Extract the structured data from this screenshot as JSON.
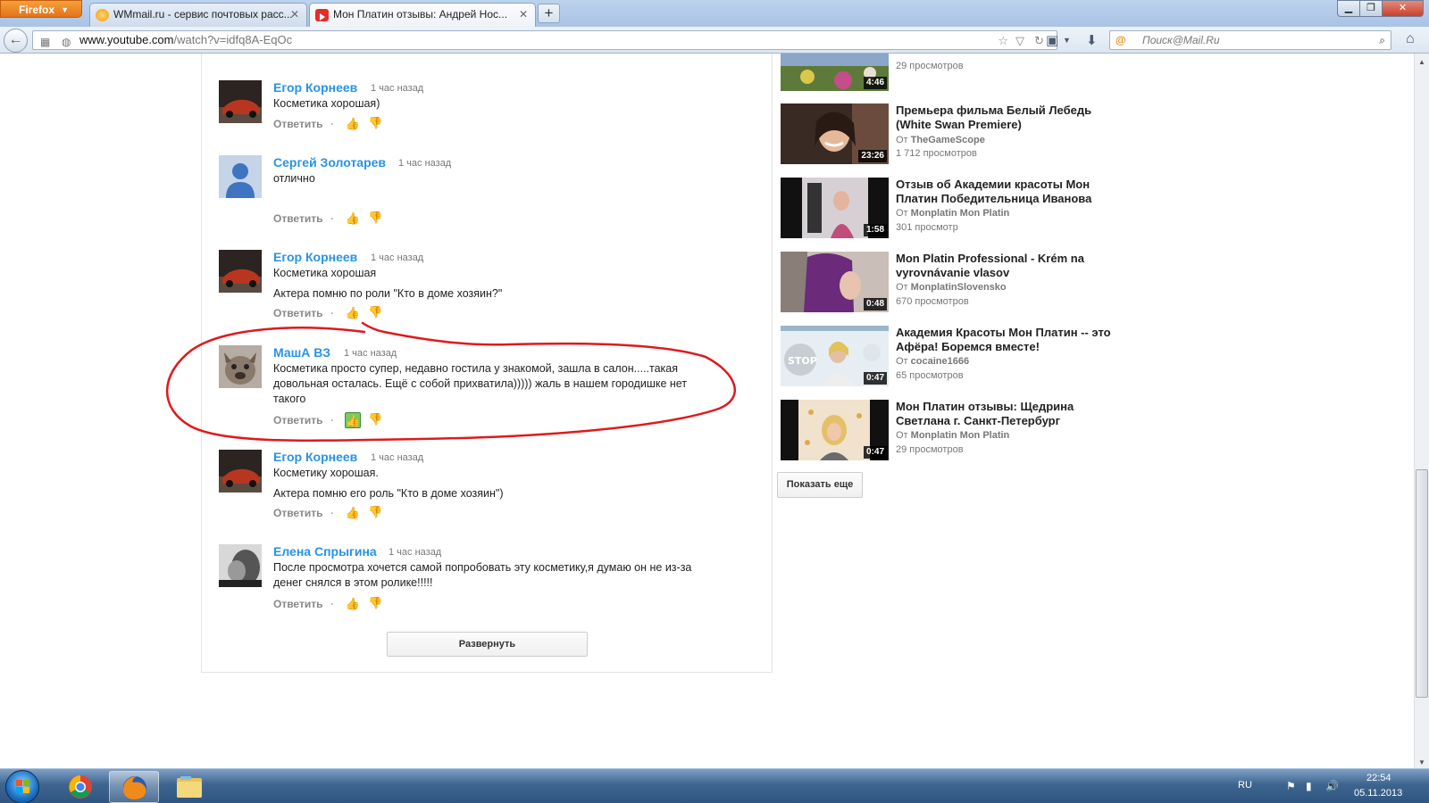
{
  "browser": {
    "menu_label": "Firefox",
    "tabs": [
      {
        "title": "WMmail.ru - сервис почтовых расс...",
        "active": false
      },
      {
        "title": "Мон Платин отзывы: Андрей Нос...",
        "active": true
      }
    ],
    "url_host": "www.youtube.com",
    "url_path": "/watch?v=idfq8A-EqOc",
    "search_placeholder": "Поиск@Mail.Ru"
  },
  "comments": [
    {
      "author": "Егор Корнеев",
      "time": "1 час назад",
      "lines": [
        "Косметика хорошая)"
      ],
      "liked": false
    },
    {
      "author": "Сергей Золотарев",
      "time": "1 час назад",
      "lines": [
        "отлично"
      ],
      "liked": false
    },
    {
      "author": "Егор Корнеев",
      "time": "1 час назад",
      "lines": [
        "Косметика хорошая",
        "Актера помню по роли \"Кто в доме хозяин?\""
      ],
      "liked": false
    },
    {
      "author": "МашА ВЗ",
      "time": "1 час назад",
      "lines": [
        "Косметика просто супер, недавно гостила у знакомой, зашла в салон.....такая довольная осталась. Ещё с собой прихватила))))) жаль в нашем городишке нет такого"
      ],
      "liked": true
    },
    {
      "author": "Егор Корнеев",
      "time": "1 час назад",
      "lines": [
        "Косметику хорошая.",
        "Актера помню его роль \"Кто в доме хозяин\")"
      ],
      "liked": false
    },
    {
      "author": "Елена Спрыгина",
      "time": "1 час назад",
      "lines": [
        "После просмотра хочется самой попробовать эту косметику,я думаю он не из-за денег снялся в этом ролике!!!!!"
      ],
      "liked": false
    }
  ],
  "reply_label": "Ответить",
  "expand_label": "Развернуть",
  "sidebar": {
    "top_views": "29 просмотров",
    "top_duration": "4:46",
    "channel_prefix": "От",
    "videos": [
      {
        "title": "Премьера фильма Белый Лебедь (White Swan Premiere)",
        "channel": "TheGameScope",
        "views": "1 712 просмотров",
        "duration": "23:26"
      },
      {
        "title": "Отзыв об Академии красоты Мон Платин Победительница Иванова",
        "channel": "Monplatin Mon Platin",
        "views": "301 просмотр",
        "duration": "1:58"
      },
      {
        "title": "Mon Platin Professional - Krém na vyrovnávanie vlasov",
        "channel": "MonplatinSlovensko",
        "views": "670 просмотров",
        "duration": "0:48"
      },
      {
        "title": "Академия Красоты Мон Платин -- это Афёра! Боремся вместе!",
        "channel": "cocaine1666",
        "views": "65 просмотров",
        "duration": "0:47"
      },
      {
        "title": "Мон Платин отзывы: Щедрина Светлана г. Санкт-Петербург",
        "channel": "Monplatin Mon Platin",
        "views": "29 просмотров",
        "duration": "0:47"
      }
    ],
    "show_more_label": "Показать еще"
  },
  "taskbar": {
    "language": "RU",
    "time": "22:54",
    "date": "05.11.2013"
  },
  "colors": {
    "link_blue": "#2793e6",
    "like_green": "#7ccb5a",
    "annotation_red": "#e0191b"
  }
}
